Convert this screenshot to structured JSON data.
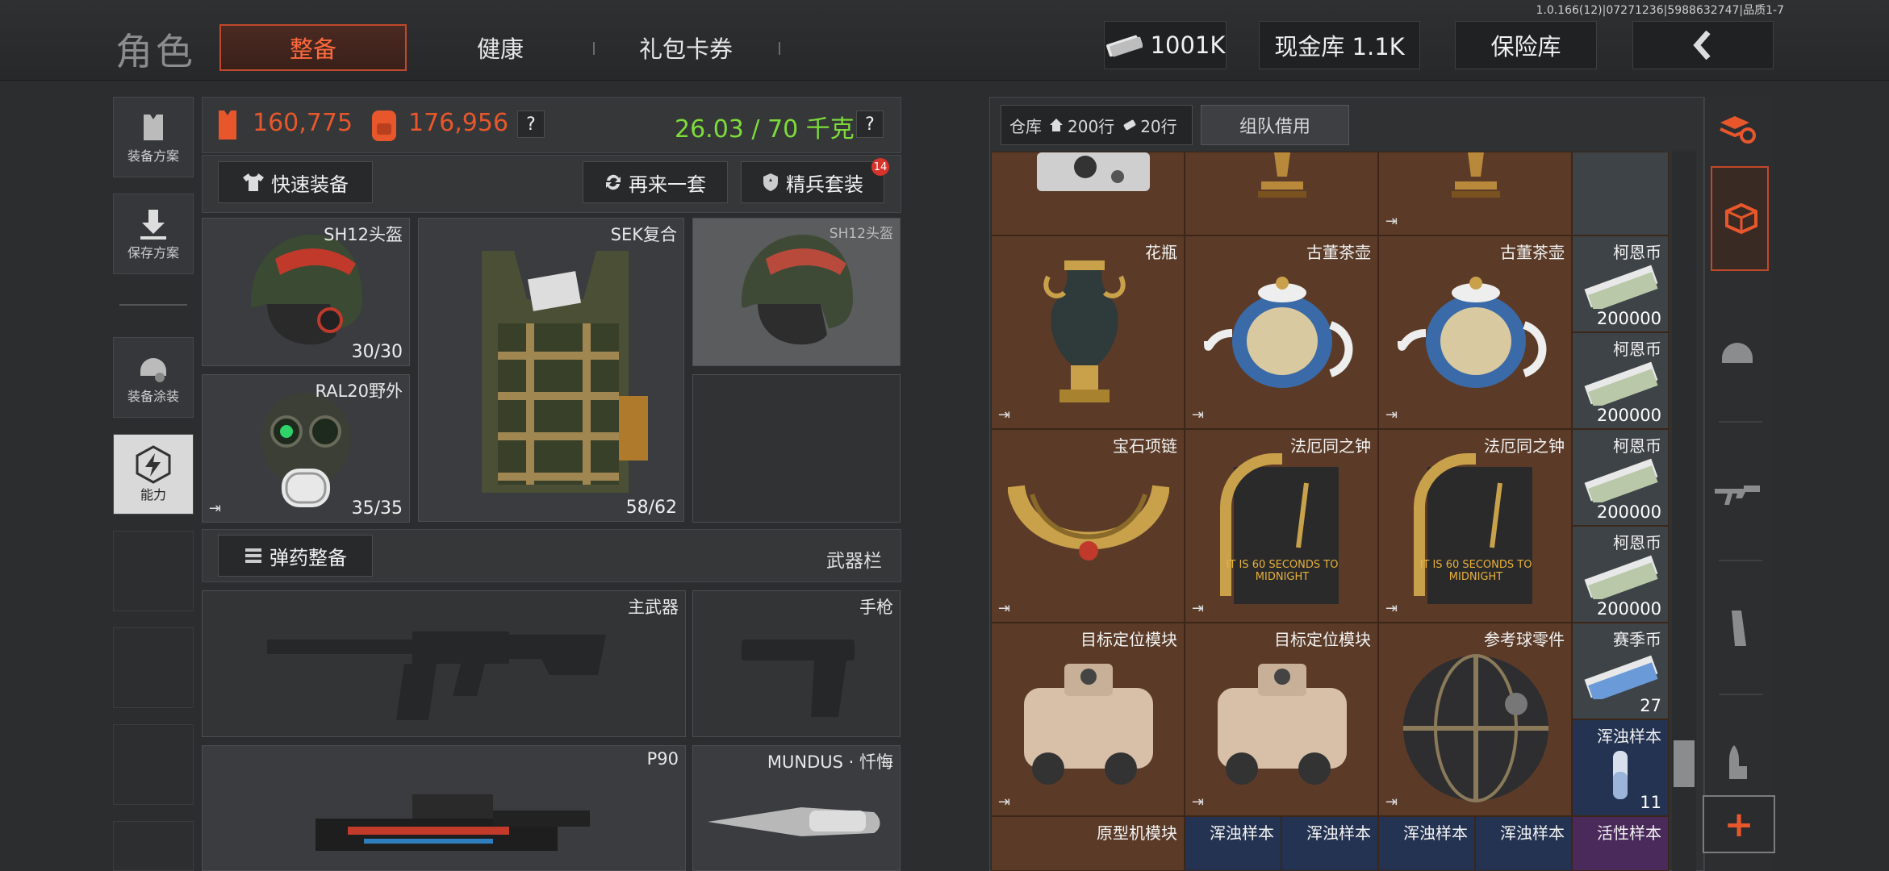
{
  "version": "1.0.166(12)|07271236|5988632747|品质1-7",
  "title": "角色",
  "tabs": [
    "整备",
    "健康",
    "礼包卡券"
  ],
  "header": {
    "currency": "1001K",
    "cash_store": "现金库 1.1K",
    "safe": "保险库",
    "back_icon": "chevron-left-icon"
  },
  "sidebar": [
    "装备方案",
    "保存方案",
    "装备涂装",
    "能力"
  ],
  "stats": {
    "value1": "160,775",
    "value2": "176,956",
    "weight": "26.03 / 70 千克",
    "help": "?"
  },
  "actions": {
    "quick_equip": "快速装备",
    "again": "再来一套",
    "elite": "精兵套装",
    "elite_badge": "14"
  },
  "gear": [
    {
      "label": "SH12头盔",
      "count": "30/30"
    },
    {
      "label": "SEK复合",
      "count": "58/62"
    },
    {
      "label": "SH12头盔",
      "count": ""
    },
    {
      "label": "RAL20野外",
      "count": "35/35"
    }
  ],
  "ammo": {
    "button": "弹药整备",
    "right": "武器栏"
  },
  "weapons": [
    {
      "label": "主武器"
    },
    {
      "label": "手枪"
    },
    {
      "label": "P90"
    },
    {
      "label": "MUNDUS · 忏悔"
    }
  ],
  "storage": {
    "label": "仓库",
    "rows1": "200行",
    "rows2": "20行",
    "team": "组队借用"
  },
  "grid": {
    "row1": [
      {
        "label": "花瓶"
      },
      {
        "label": "古董茶壶"
      },
      {
        "label": "古董茶壶"
      }
    ],
    "coins": [
      {
        "label": "柯恩币",
        "count": "200000"
      },
      {
        "label": "柯恩币",
        "count": "200000"
      },
      {
        "label": "柯恩币",
        "count": "200000"
      },
      {
        "label": "柯恩币",
        "count": "200000"
      }
    ],
    "row2": [
      {
        "label": "宝石项链"
      },
      {
        "label": "法厄同之钟"
      },
      {
        "label": "法厄同之钟"
      }
    ],
    "row3": [
      {
        "label": "目标定位模块"
      },
      {
        "label": "目标定位模块"
      },
      {
        "label": "参考球零件"
      }
    ],
    "season": {
      "label": "赛季币",
      "count": "27"
    },
    "sample": {
      "label": "浑浊样本",
      "count": "11"
    },
    "bottom": [
      "原型机模块",
      "浑浊样本",
      "浑浊样本",
      "浑浊样本",
      "浑浊样本",
      "活性样本"
    ],
    "clock_text": "IT IS 60 SECONDS TO MIDNIGHT"
  },
  "plus": "+",
  "colors": {
    "accent": "#ff6a3d",
    "green": "#7ddc3a",
    "orange": "#e8572c"
  }
}
